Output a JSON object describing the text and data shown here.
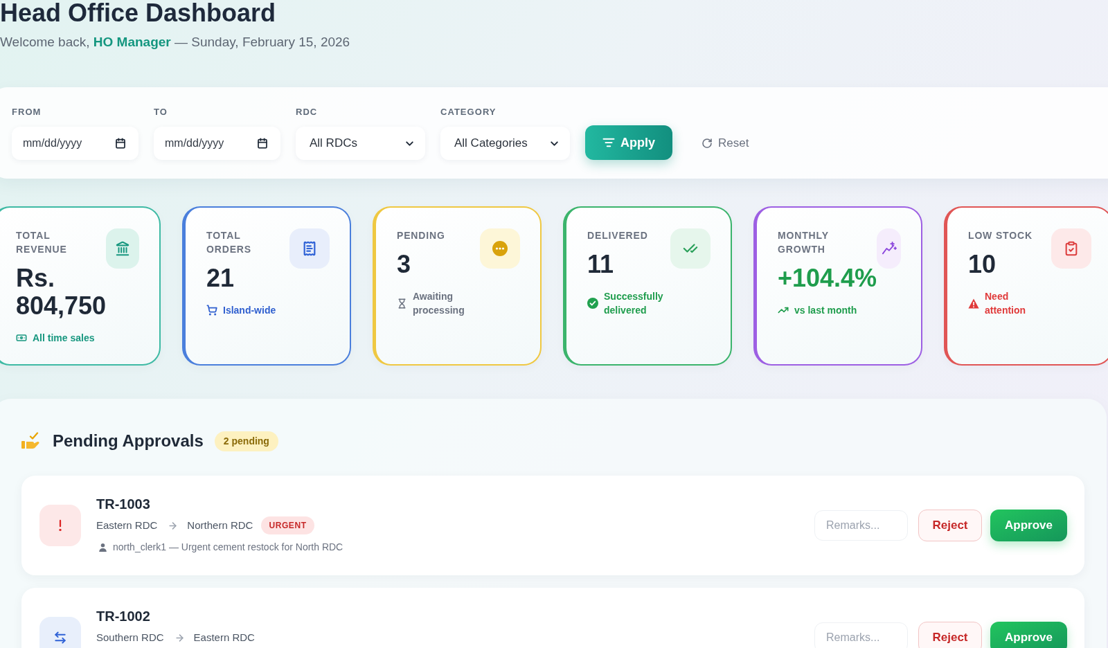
{
  "header": {
    "title": "Head Office Dashboard",
    "subtitle": "Welcome back, **HO Manager** — Sunday, February 15, 2026"
  },
  "filters": {
    "fields": [
      {
        "kind": "date",
        "label": "FROM",
        "placeholder": "mm/dd/yyyy"
      },
      {
        "kind": "date",
        "label": "TO",
        "placeholder": "mm/dd/yyyy"
      },
      {
        "kind": "select",
        "label": "RDC",
        "value": "All RDCs"
      },
      {
        "kind": "select",
        "label": "CATEGORY",
        "value": "All Categories"
      }
    ],
    "apply_button": "Apply",
    "reset_button": "Reset"
  },
  "stats": [
    {
      "kind": "amount",
      "label": "TOTAL REVENUE",
      "value": "Rs. 804,750",
      "note": "All time sales",
      "color": "#3ebaa4"
    },
    {
      "kind": "count",
      "label": "TOTAL ORDERS",
      "value": "21",
      "note": "Island-wide",
      "color": "#4a7fdc"
    },
    {
      "kind": "count",
      "label": "PENDING",
      "value": "3",
      "note": "Awaiting processing",
      "color": "#efc842"
    },
    {
      "kind": "count",
      "label": "DELIVERED",
      "value": "11",
      "note": "Successfully delivered",
      "color": "#3bb46c"
    },
    {
      "kind": "growth",
      "label": "MONTHLY GROWTH",
      "value": "+104.4%",
      "note": "vs last month",
      "color": "#9d5fe3"
    },
    {
      "kind": "count",
      "label": "LOW STOCK",
      "value": "10",
      "note": "Need attention",
      "color": "#e05555"
    }
  ],
  "pending_approvals": {
    "title": "Pending Approvals",
    "badge": "2 pending",
    "items": [
      {
        "id": "TR-1003",
        "from": "Eastern RDC",
        "to": "Northern RDC",
        "urgent": true,
        "tag": "URGENT",
        "requester": "north_clerk1 — Urgent cement restock for North RDC",
        "remarks_placeholder": "Remarks...",
        "reject_button": "Reject",
        "approve_button": "Approve"
      },
      {
        "id": "TR-1002",
        "from": "Southern RDC",
        "to": "Eastern RDC",
        "urgent": false,
        "remarks_placeholder": "Remarks...",
        "reject_button": "Reject",
        "approve_button": "Approve"
      }
    ]
  }
}
